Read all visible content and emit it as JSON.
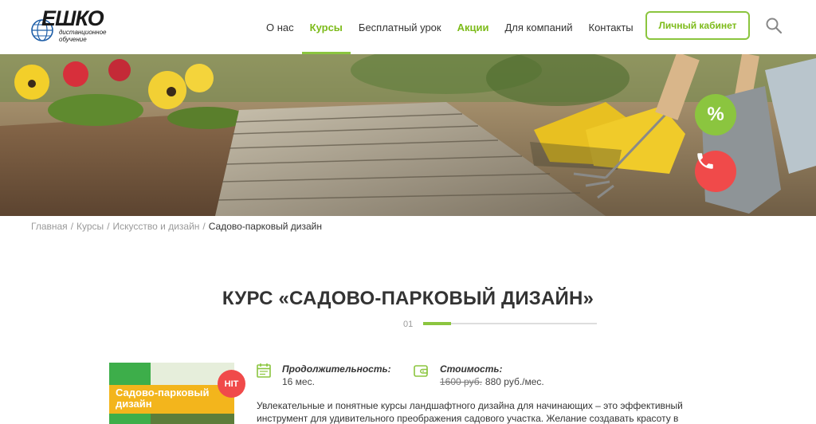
{
  "logo": {
    "name": "ЕШКО",
    "subtitle_line1": "дистанционное",
    "subtitle_line2": "обучение"
  },
  "nav": {
    "items": [
      {
        "label": "О нас"
      },
      {
        "label": "Курсы"
      },
      {
        "label": "Бесплатный урок"
      },
      {
        "label": "Акции"
      },
      {
        "label": "Для компаний"
      },
      {
        "label": "Контакты"
      }
    ],
    "active": "Курсы",
    "cabinet_label": "Личный кабинет"
  },
  "hero": {
    "discount_symbol": "%"
  },
  "breadcrumb": {
    "items": [
      {
        "label": "Главная"
      },
      {
        "label": "Курсы"
      },
      {
        "label": "Искусство и дизайн"
      },
      {
        "label": "Садово-парковый дизайн"
      }
    ],
    "separator": "/"
  },
  "course": {
    "title": "КУРС «САДОВО-ПАРКОВЫЙ ДИЗАЙН»",
    "slide_number": "01",
    "slide_progress": 0.16,
    "cover_title_line1": "Садово-парковый",
    "cover_title_line2": "дизайн",
    "badge": "HIT",
    "duration_label": "Продолжительность:",
    "duration_value": "16 мес.",
    "price_label": "Стоимость:",
    "price_old": "1600 руб.",
    "price_new": "880 руб./мес.",
    "description_line1": "Увлекательные и понятные курсы ландшафтного дизайна для начинающих – это эффективный",
    "description_line2": "инструмент для удивительного преображения садового участка. Желание создавать красоту в"
  },
  "colors": {
    "accent": "#8bc53f",
    "accent_text": "#7dbb1a",
    "red": "#f04a4a",
    "cover_yellow": "#f3b51c",
    "cover_green": "#3dae4a"
  },
  "icons": {
    "search": "search-icon",
    "phone": "phone-icon",
    "calendar": "calendar-icon",
    "wallet": "wallet-icon",
    "globe": "globe-icon"
  }
}
